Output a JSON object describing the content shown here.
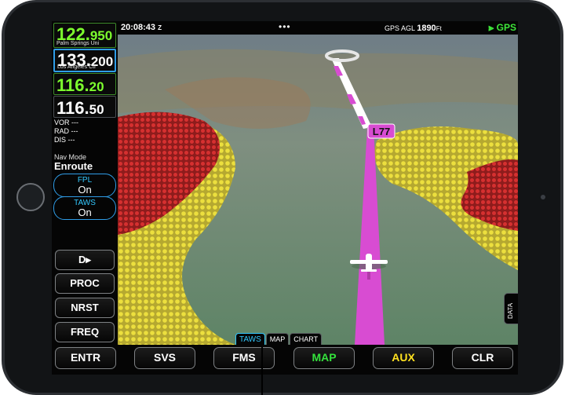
{
  "radio": {
    "com1": {
      "mhz": "122.",
      "decimal": "950",
      "station": "Palm Springs Uni"
    },
    "com2": {
      "mhz": "133.",
      "decimal": "200",
      "station": "Los Angeles Ctr"
    },
    "nav1": {
      "mhz": "116.",
      "decimal": "20"
    },
    "nav2": {
      "mhz": "116.",
      "decimal": "50"
    }
  },
  "nav_info": {
    "vor": "VOR ---",
    "rad": "RAD ---",
    "dis": "DIS  ---"
  },
  "nav_mode": {
    "label": "Nav Mode",
    "value": "Enroute"
  },
  "toggles": {
    "fpl": {
      "label": "FPL",
      "value": "On"
    },
    "taws": {
      "label": "TAWS",
      "value": "On"
    }
  },
  "left_buttons": {
    "direct": "D▸",
    "proc": "PROC",
    "nrst": "NRST",
    "freq": "FREQ"
  },
  "status": {
    "time": "20:08:43",
    "zulu": "Z",
    "dots": "•••",
    "agl_label": "GPS AGL",
    "agl_value": "1890",
    "agl_unit": "Ft",
    "gps": "GPS"
  },
  "waypoint": "L77",
  "view_tabs": [
    "TAWS",
    "MAP",
    "CHART"
  ],
  "data_tab": "DATA",
  "bottom_buttons": [
    "ENTR",
    "SVS",
    "FMS",
    "MAP",
    "AUX",
    "CLR"
  ],
  "colors": {
    "freq_green": "#7dff2e",
    "accent_blue": "#33c8ff",
    "map_green": "#34e23c",
    "aux_yellow": "#ffe11f",
    "route_magenta": "#d84cd2",
    "taws_red": "#d22a2a",
    "taws_yellow": "#e6d83a",
    "gps_green": "#3ee63a"
  }
}
